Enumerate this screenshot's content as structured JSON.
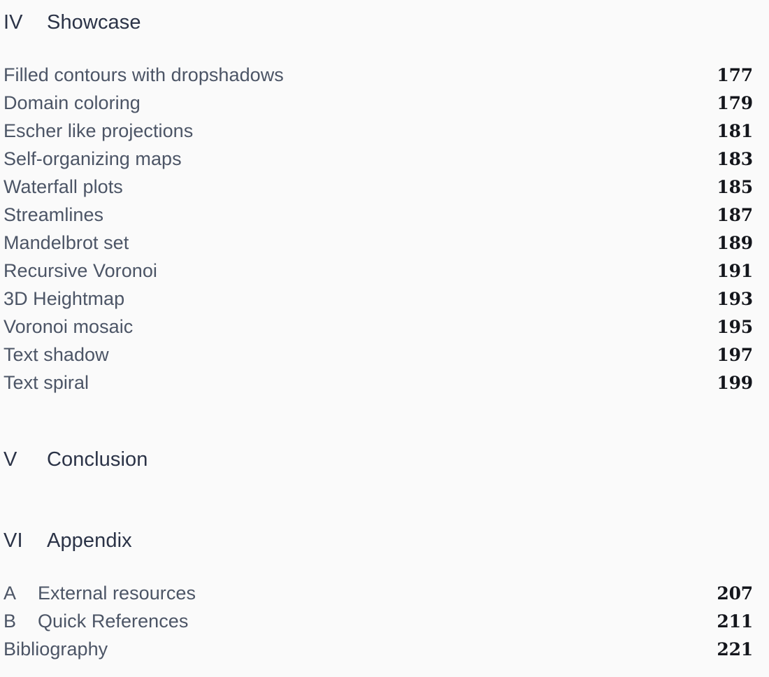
{
  "document": {
    "kind": "table-of-contents",
    "background_color": "#fafafa",
    "heading_color": "#2b3347",
    "entry_color": "#4c5566",
    "page_number_color": "#14161c"
  },
  "parts": [
    {
      "number": "IV",
      "title": "Showcase",
      "entries": [
        {
          "prefix": "",
          "label": "Filled contours with dropshadows",
          "page": "177"
        },
        {
          "prefix": "",
          "label": "Domain coloring",
          "page": "179"
        },
        {
          "prefix": "",
          "label": "Escher like projections",
          "page": "181"
        },
        {
          "prefix": "",
          "label": "Self-organizing maps",
          "page": "183"
        },
        {
          "prefix": "",
          "label": "Waterfall plots",
          "page": "185"
        },
        {
          "prefix": "",
          "label": "Streamlines",
          "page": "187"
        },
        {
          "prefix": "",
          "label": "Mandelbrot set",
          "page": "189"
        },
        {
          "prefix": "",
          "label": "Recursive Voronoi",
          "page": "191"
        },
        {
          "prefix": "",
          "label": "3D Heightmap",
          "page": "193"
        },
        {
          "prefix": "",
          "label": "Voronoi mosaic",
          "page": "195"
        },
        {
          "prefix": "",
          "label": "Text shadow",
          "page": "197"
        },
        {
          "prefix": "",
          "label": "Text spiral",
          "page": "199"
        }
      ]
    },
    {
      "number": "V",
      "title": "Conclusion",
      "entries": []
    },
    {
      "number": "VI",
      "title": "Appendix",
      "entries": [
        {
          "prefix": "A",
          "label": "External resources",
          "page": "207"
        },
        {
          "prefix": "B",
          "label": "Quick References",
          "page": "211"
        },
        {
          "prefix": "",
          "label": "Bibliography",
          "page": "221"
        }
      ]
    }
  ]
}
